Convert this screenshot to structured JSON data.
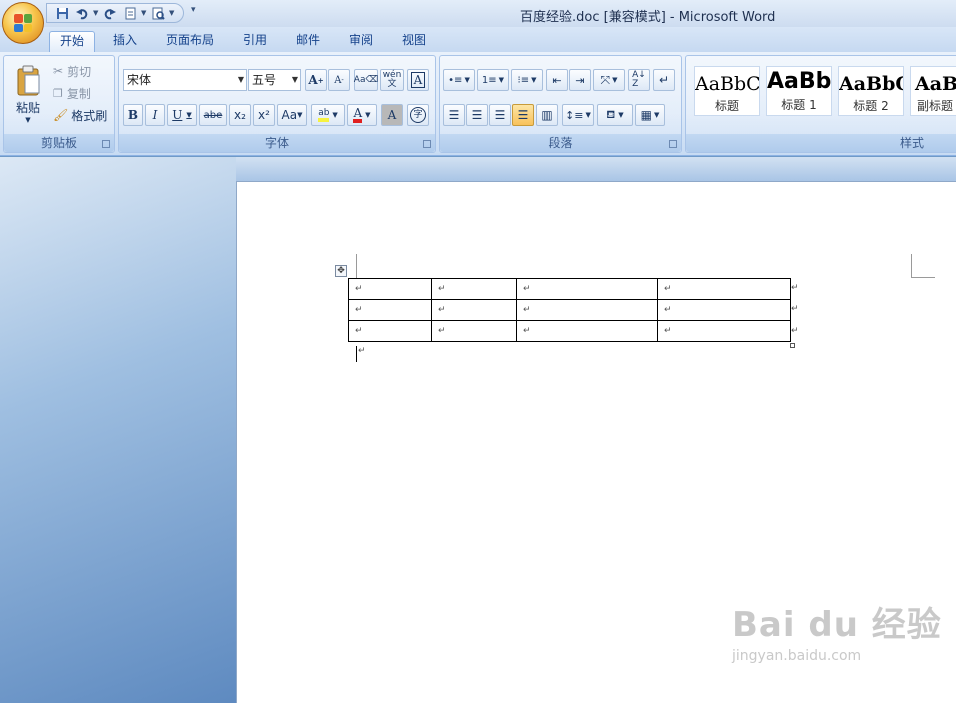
{
  "window": {
    "title": "百度经验.doc [兼容模式] - Microsoft Word"
  },
  "qat": {
    "icons": [
      "save-icon",
      "undo-icon",
      "redo-icon",
      "new-doc-icon",
      "print-preview-icon"
    ]
  },
  "tabs": [
    "开始",
    "插入",
    "页面布局",
    "引用",
    "邮件",
    "审阅",
    "视图"
  ],
  "clipboard": {
    "paste": "粘贴",
    "cut": "剪切",
    "copy": "复制",
    "format_painter": "格式刷",
    "label": "剪贴板"
  },
  "font": {
    "name": "宋体",
    "size": "五号",
    "label": "字体",
    "buttons": {
      "bold": "B",
      "italic": "I",
      "underline": "U",
      "strike": "abe",
      "sub": "x₂",
      "sup": "x²",
      "case": "Aa",
      "grow": "A",
      "shrink": "A",
      "wen": "wén",
      "border_char": "A",
      "shade": "A",
      "circled": "字"
    }
  },
  "paragraph": {
    "label": "段落"
  },
  "styles": {
    "label": "样式",
    "items": [
      {
        "sample": "AaBbC",
        "name": "标题"
      },
      {
        "sample": "AaBb",
        "name": "标题 1"
      },
      {
        "sample": "AaBbC",
        "name": "标题 2"
      },
      {
        "sample": "AaBl",
        "name": "副标题"
      }
    ]
  },
  "document": {
    "table": {
      "rows": 3,
      "cols": 4,
      "cell_mark": "↵"
    },
    "paragraph_mark": "↵"
  },
  "watermark": {
    "brand": "Bai du 经验",
    "url": "jingyan.baidu.com"
  },
  "colors": {
    "accent": "#15428b",
    "highlight": "#f8c15b",
    "font_color": "#e02020",
    "marker_color": "#f6f240"
  }
}
